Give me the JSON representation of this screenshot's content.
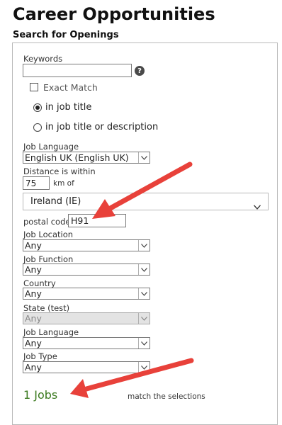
{
  "page": {
    "title": "Career Opportunities",
    "section_title": "Search for Openings"
  },
  "form": {
    "keywords": {
      "label": "Keywords",
      "value": "",
      "help_icon": "question-circle-icon"
    },
    "exact_match": {
      "label": "Exact Match",
      "checked": false
    },
    "search_scope": [
      {
        "label": "in job title",
        "selected": true
      },
      {
        "label": "in job title or description",
        "selected": false
      }
    ],
    "job_language_top": {
      "label": "Job Language",
      "value": "English UK (English UK)"
    },
    "distance": {
      "label": "Distance is within",
      "value": "75",
      "unit": "km of"
    },
    "country_select": {
      "value": "Ireland (IE)"
    },
    "postal_code": {
      "label": "postal code",
      "value": "H91"
    },
    "filters": [
      {
        "label": "Job Location",
        "value": "Any",
        "disabled": false
      },
      {
        "label": "Job Function",
        "value": "Any",
        "disabled": false
      },
      {
        "label": "Country",
        "value": "Any",
        "disabled": false
      },
      {
        "label": "State (test)",
        "value": "Any",
        "disabled": true
      },
      {
        "label": "Job Language",
        "value": "Any",
        "disabled": false
      },
      {
        "label": "Job Type",
        "value": "Any",
        "disabled": false
      }
    ]
  },
  "results": {
    "count_text": "1 Jobs",
    "match_text": "match the selections"
  },
  "colors": {
    "annotation_arrow": "#e8413a",
    "jobs_count": "#3b7a1f"
  }
}
